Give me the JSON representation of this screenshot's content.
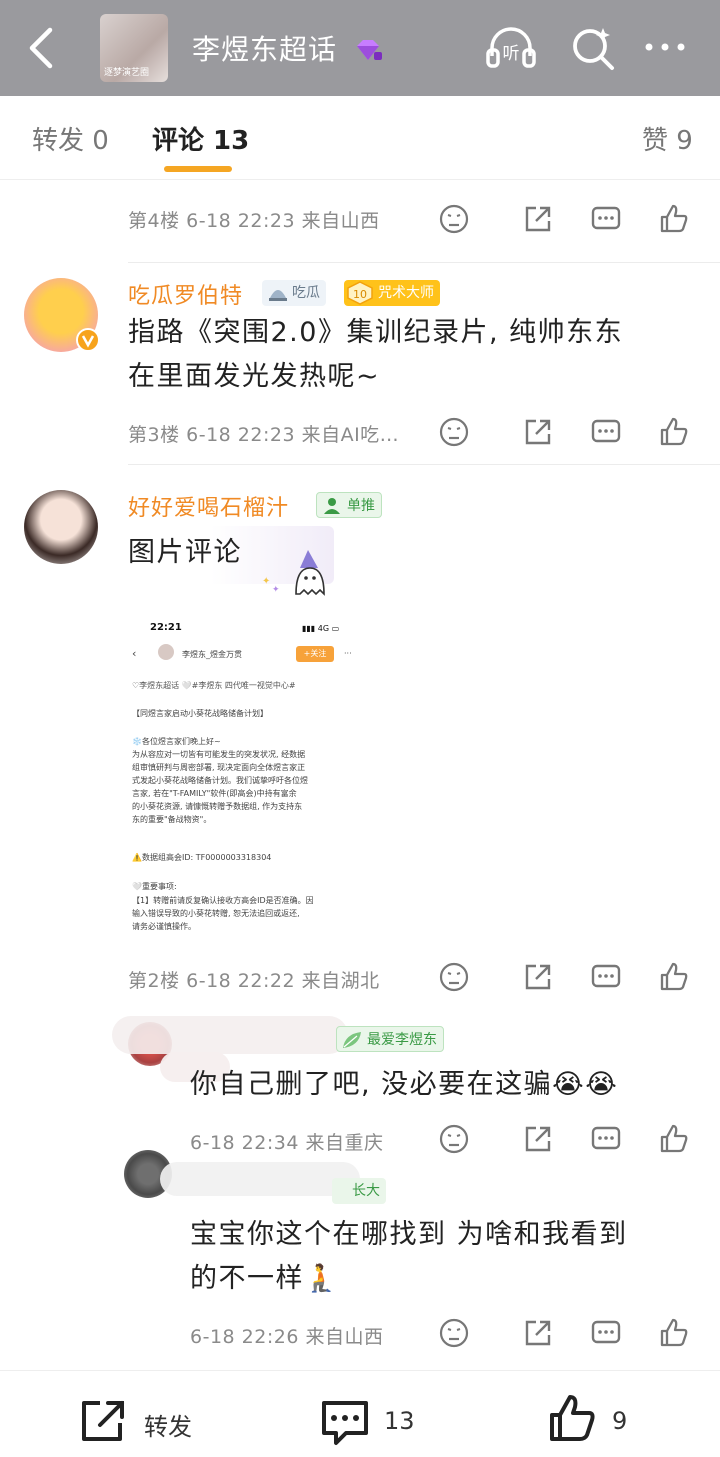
{
  "header": {
    "topic_title": "李煜东超话",
    "cover_caption": "逐梦演艺圈"
  },
  "tabs": [
    {
      "label": "转发 0"
    },
    {
      "label": "评论 13"
    },
    {
      "label": "赞 9"
    }
  ],
  "comments": [
    {
      "floor_meta": "第4楼 6-18 22:23 来自山西"
    },
    {
      "user": "吃瓜罗伯特",
      "badge1": "吃瓜",
      "badge2_level": "10",
      "badge2": "咒术大师",
      "text_line1": "指路《突围2.0》集训纪录片, 纯帅东东",
      "text_line2": "在里面发光发热呢~",
      "floor_meta": "第3楼 6-18 22:23 来自AI吃…"
    },
    {
      "user": "好好爱喝石榴汁",
      "badge1": "单推",
      "text_line1": "图片评论",
      "floor_meta": "第2楼 6-18 22:22 来自湖北"
    }
  ],
  "embedded": {
    "time": "22:21",
    "network": "4G",
    "account": "李煜东_煜金万贯",
    "follow": "+关注",
    "tags": "♡李煜东超话 🤍#李煜东 四代唯一视觉中心#",
    "headline": "【同煜言家启动小葵花战略储备计划】",
    "p1": "❄️各位煜言家们晚上好~",
    "p2": "为从容应对一切皆有可能发生的突发状况, 经数据",
    "p3": "组审慎研判与周密部署, 现决定面向全体煜言家正",
    "p4": "式发起小葵花战略储备计划。我们诚挚呼吁各位煜",
    "p5": "言家, 若在\"T-FAMILY\"软件(即高会)中持有富余",
    "p6": "的小葵花资源, 请慷慨转赠予数据组, 作为支持东",
    "p7": "东的重要\"备战物资\"。",
    "id_line": "⚠️数据组高会ID: TF0000003318304",
    "note_title": "🤍重要事项:",
    "note1": "【1】转赠前请反复确认接收方高会ID是否准确。因",
    "note2": "输入错误导致的小葵花转赠, 恕无法追回或返还,",
    "note3": "请务必谨慎操作。"
  },
  "replies": [
    {
      "badge": "最爱李煜东",
      "text": "你自己删了吧, 没必要在这骗😭😭",
      "meta": "6-18 22:34 来自重庆"
    },
    {
      "badge": "长大",
      "text_line1": "宝宝你这个在哪找到 为啥和我看到",
      "text_line2": "的不一样🧎",
      "meta": "6-18 22:26 来自山西"
    }
  ],
  "bottom": {
    "repost_label": "转发",
    "comment_count": "13",
    "like_count": "9"
  },
  "colors": {
    "accent": "#f5a623",
    "username": "#f08a24",
    "topbar": "#9a9a9e"
  }
}
